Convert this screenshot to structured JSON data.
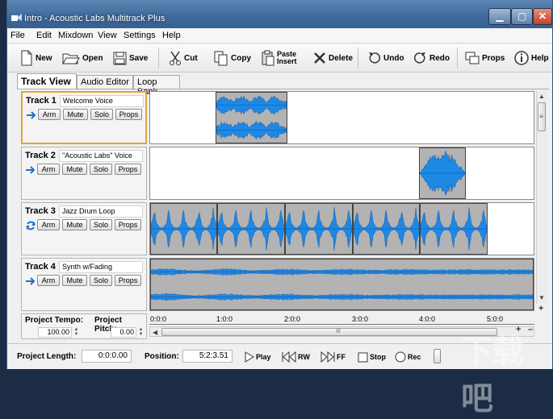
{
  "window": {
    "title": "Intro - Acoustic Labs Multitrack Plus",
    "min_symbol": "▁",
    "max_symbol": "▢",
    "close_symbol": "✕"
  },
  "menu": [
    "File",
    "Edit",
    "Mixdown",
    "View",
    "Settings",
    "Help"
  ],
  "toolbar": {
    "new": "New",
    "open": "Open",
    "save": "Save",
    "cut": "Cut",
    "copy": "Copy",
    "paste_line1": "Paste",
    "paste_line2": "Insert",
    "delete": "Delete",
    "undo": "Undo",
    "redo": "Redo",
    "props": "Props",
    "help": "Help"
  },
  "tabs": [
    "Track View",
    "Audio Editor",
    "Loop Bank"
  ],
  "tracks": [
    {
      "label": "Track 1",
      "name": "Welcome Voice",
      "icon": "arrow-icon",
      "selected": true
    },
    {
      "label": "Track 2",
      "name": "\"Acoustic Labs\" Voice",
      "icon": "arrow-icon",
      "selected": false
    },
    {
      "label": "Track 3",
      "name": "Jazz Drum Loop",
      "icon": "loop-icon",
      "selected": false
    },
    {
      "label": "Track 4",
      "name": "Synth w/Fading",
      "icon": "arrow-icon",
      "selected": false
    }
  ],
  "track_buttons": {
    "arm": "Arm",
    "mute": "Mute",
    "solo": "Solo",
    "props": "Props"
  },
  "project": {
    "tempo_label": "Project Tempo:",
    "tempo": "100.00",
    "pitch_label": "Project Pitch:",
    "pitch": "0.00"
  },
  "ruler": [
    "0:0:0",
    "1:0:0",
    "2:0:0",
    "3:0:0",
    "4:0:0",
    "5:0:0"
  ],
  "scroll": {
    "hgrip": "III",
    "up": "▲",
    "down": "▼",
    "left": "◀",
    "grip": "≡"
  },
  "zoom": {
    "in": "+",
    "out": "–"
  },
  "status": {
    "length_label": "Project Length:",
    "length": "0:0:0.00",
    "position_label": "Position:",
    "position": "5:2:3.51",
    "play": "Play",
    "rw": "RW",
    "ff": "FF",
    "stop": "Stop",
    "rec": "Rec"
  },
  "colors": {
    "wave": "#1e88e5",
    "clip": "#b3b3b3",
    "selected_border": "#e2a43a",
    "titlebar": "#3f6a9c"
  },
  "watermark": "下载吧"
}
